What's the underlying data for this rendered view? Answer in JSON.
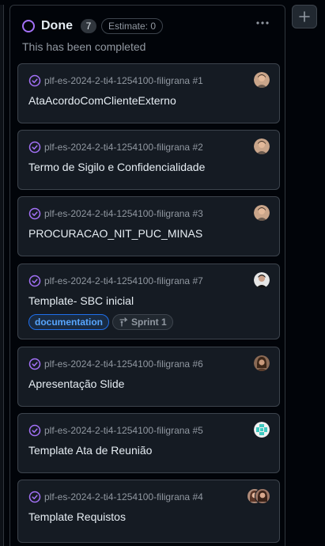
{
  "column": {
    "title": "Done",
    "count": "7",
    "estimate": "Estimate: 0",
    "description": "This has been completed",
    "status_color": "#a371f7"
  },
  "cards": [
    {
      "ref": "plf-es-2024-2-ti4-1254100-filigrana #1",
      "title": "AtaAcordoComClienteExterno",
      "avatar": "person-avatar"
    },
    {
      "ref": "plf-es-2024-2-ti4-1254100-filigrana #2",
      "title": "Termo de Sigilo e Confidencialidade",
      "avatar": "person-avatar"
    },
    {
      "ref": "plf-es-2024-2-ti4-1254100-filigrana #3",
      "title": "PROCURACAO_NIT_PUC_MINAS",
      "avatar": "person-avatar"
    },
    {
      "ref": "plf-es-2024-2-ti4-1254100-filigrana #7",
      "title": "Template- SBC inicial",
      "avatar": "person-avatar",
      "labels": {
        "documentation": "documentation",
        "sprint": "Sprint 1"
      }
    },
    {
      "ref": "plf-es-2024-2-ti4-1254100-filigrana #6",
      "title": "Apresentação Slide",
      "avatar": "person-avatar"
    },
    {
      "ref": "plf-es-2024-2-ti4-1254100-filigrana #5",
      "title": "Template Ata de Reunião",
      "avatar": "identicon-avatar"
    },
    {
      "ref": "plf-es-2024-2-ti4-1254100-filigrana #4",
      "title": "Template Requistos",
      "avatar": "stacked-avatars"
    }
  ],
  "colors": {
    "done_purple": "#a371f7",
    "label_blue": "#58a6ff",
    "card_bg": "#151b23"
  }
}
